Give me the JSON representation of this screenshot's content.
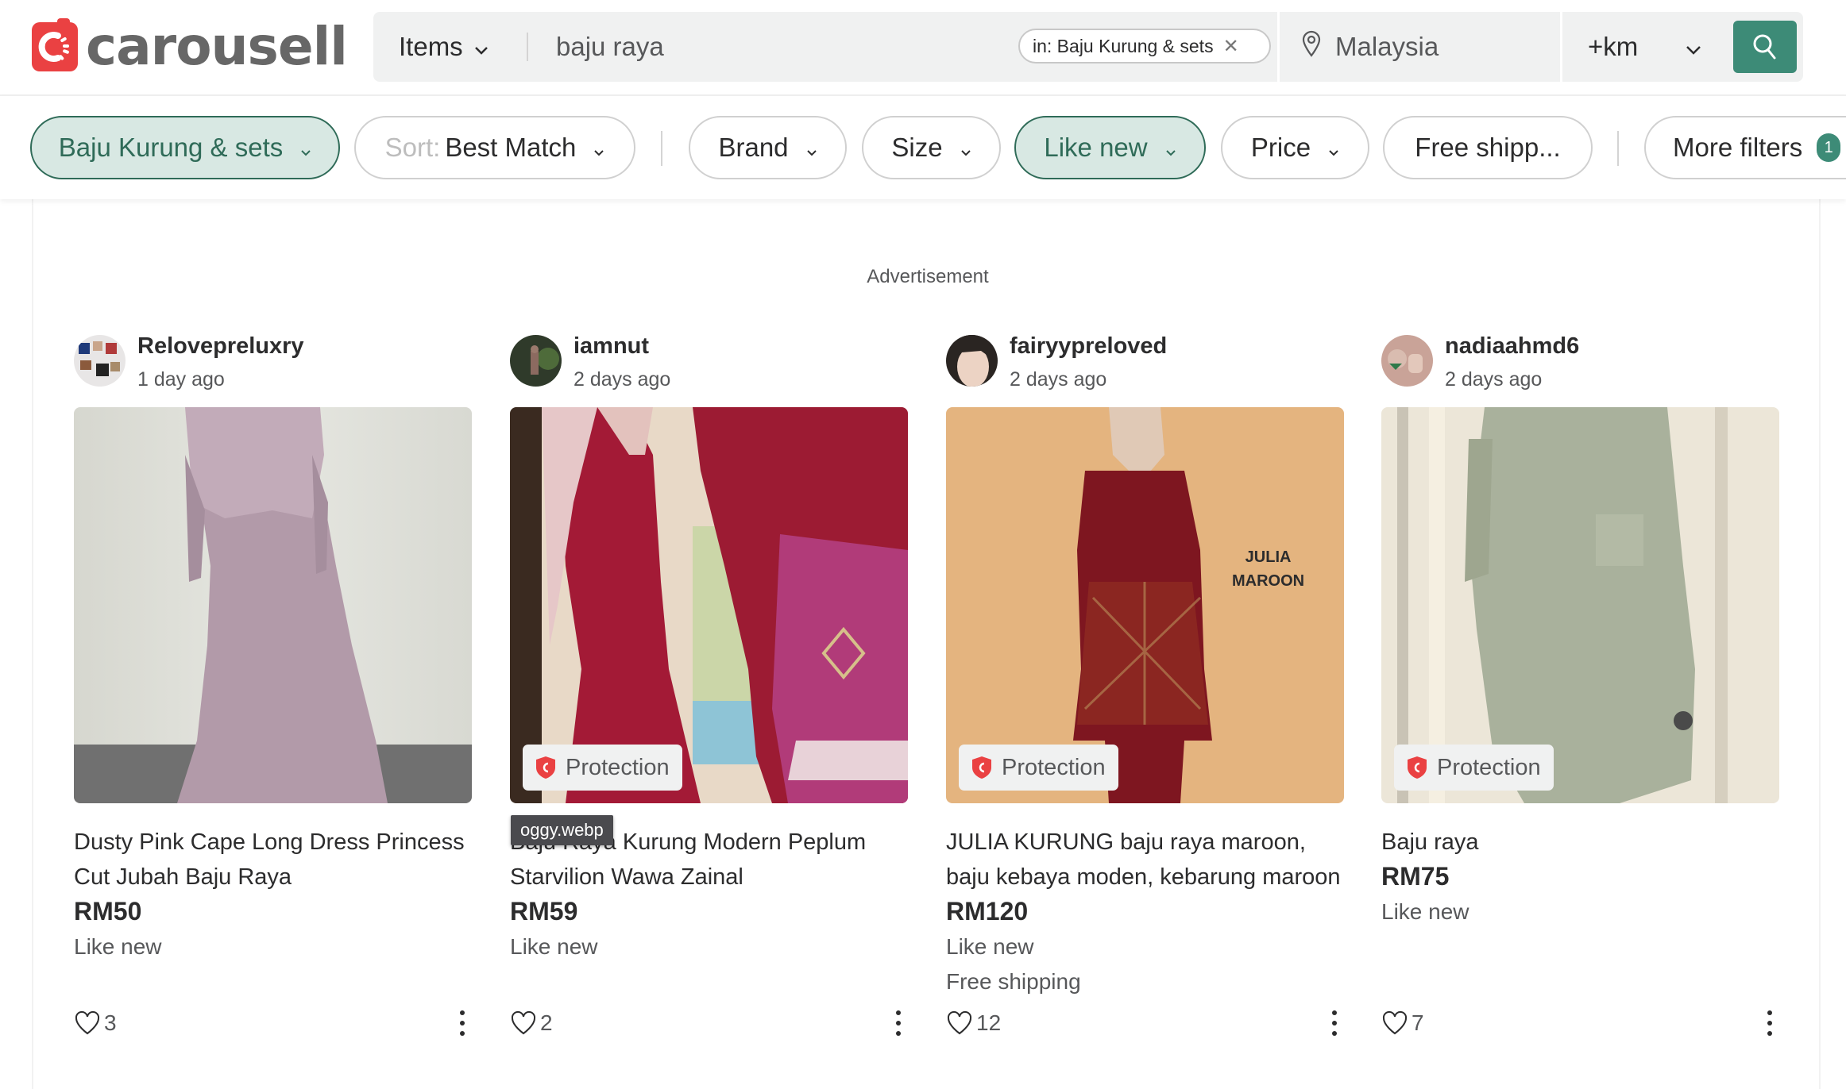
{
  "header": {
    "logo_text": "carousell",
    "search": {
      "scope_label": "Items",
      "query": "baju raya",
      "category_chip": "in: Baju Kurung & sets",
      "location": "Malaysia",
      "distance_label": "+km"
    }
  },
  "colors": {
    "brand_red": "#ea4142",
    "accent_green": "#3d8b77",
    "active_pill_bg": "#d8e8e3",
    "active_pill_border": "#2f6b58"
  },
  "filters": {
    "category": "Baju Kurung & sets",
    "sort_prefix": "Sort:",
    "sort_value": "Best Match",
    "brand": "Brand",
    "size": "Size",
    "condition": "Like new",
    "price": "Price",
    "free_shipping": "Free shipp...",
    "more_filters": "More filters",
    "more_filters_count": "1"
  },
  "main": {
    "ad_label": "Advertisement",
    "tooltip": "oggy.webp",
    "listings": [
      {
        "seller": "Relovepreluxry",
        "posted": "1 day ago",
        "title": "Dusty Pink Cape Long Dress Princess Cut Jubah Baju Raya",
        "price": "RM50",
        "condition": "Like new",
        "shipping": "",
        "protection": "",
        "likes": "3"
      },
      {
        "seller": "iamnut",
        "posted": "2 days ago",
        "title": "Baju Raya Kurung Modern Peplum Starvilion Wawa Zainal",
        "price": "RM59",
        "condition": "Like new",
        "shipping": "",
        "protection": "Protection",
        "likes": "2"
      },
      {
        "seller": "fairyypreloved",
        "posted": "2 days ago",
        "title": "JULIA KURUNG baju raya maroon, baju kebaya moden, kebarung maroon",
        "price": "RM120",
        "condition": "Like new",
        "shipping": "Free shipping",
        "protection": "Protection",
        "likes": "12",
        "image_text_1": "JULIA",
        "image_text_2": "MAROON"
      },
      {
        "seller": "nadiaahmd6",
        "posted": "2 days ago",
        "title": "Baju raya",
        "price": "RM75",
        "condition": "Like new",
        "shipping": "",
        "protection": "Protection",
        "likes": "7"
      }
    ]
  }
}
